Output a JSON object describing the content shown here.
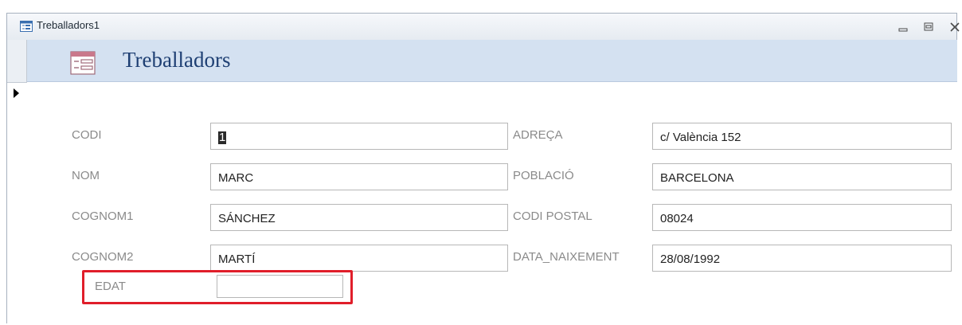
{
  "window": {
    "title": "Treballadors1",
    "controls": [
      "minimize",
      "restore",
      "close"
    ]
  },
  "form": {
    "title": "Treballadors"
  },
  "fields": {
    "codi": {
      "label": "CODI",
      "value": "1"
    },
    "nom": {
      "label": "NOM",
      "value": "MARC"
    },
    "cognom1": {
      "label": "COGNOM1",
      "value": "SÁNCHEZ"
    },
    "cognom2": {
      "label": "COGNOM2",
      "value": "MARTÍ"
    },
    "adreca": {
      "label": "ADREÇA",
      "value": "c/ València 152"
    },
    "poblacio": {
      "label": "POBLACIÓ",
      "value": "BARCELONA"
    },
    "codi_postal": {
      "label": "CODI POSTAL",
      "value": "08024"
    },
    "data_naixement": {
      "label": "DATA_NAIXEMENT",
      "value": "28/08/1992"
    },
    "edat": {
      "label": "EDAT",
      "value": ""
    }
  },
  "highlight_color": "#e01e2a",
  "icons": [
    "form-icon",
    "minimize-icon",
    "restore-icon",
    "close-icon",
    "record-selector-arrow-icon"
  ]
}
